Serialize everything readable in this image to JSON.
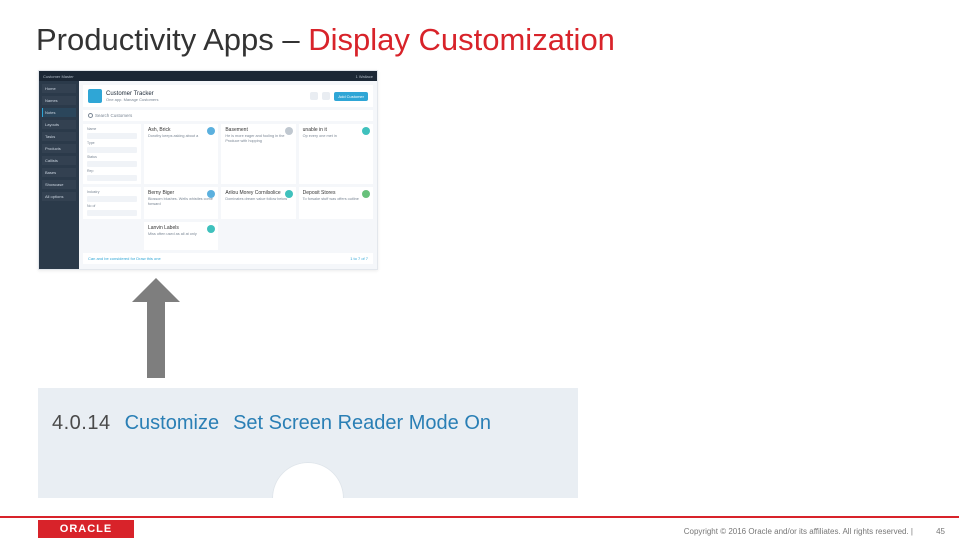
{
  "title": {
    "prefix": "Productivity Apps – ",
    "emph": "Display Customization"
  },
  "screenshot": {
    "topbar": {
      "left": "Customer Master",
      "right": "1  Wallace"
    },
    "sidebar": [
      {
        "label": "Home",
        "active": false
      },
      {
        "label": "Names",
        "active": false
      },
      {
        "label": "Notes",
        "active": true
      },
      {
        "label": "Layouts",
        "active": false
      },
      {
        "label": "Tasks",
        "active": false
      },
      {
        "label": "Products",
        "active": false
      },
      {
        "label": "Callists",
        "active": false
      },
      {
        "label": "Bases",
        "active": false
      },
      {
        "label": "Showcase",
        "active": false
      },
      {
        "label": "All options",
        "active": false
      }
    ],
    "header": {
      "title": "Customer Tracker",
      "subtitle": "One app. Manage Customers",
      "button": "Add Customer"
    },
    "search": "Search Customers",
    "cards": [
      {
        "name": "Ash, Brick",
        "desc": "Dorothy keeps asking about a",
        "avatar": "c-blue"
      },
      {
        "name": "Basement",
        "desc": "He is more eager and fooling in the Produce with hopping",
        "avatar": "c-gray"
      },
      {
        "name": "unable in it",
        "desc": "Op every one met in",
        "avatar": "c-teal"
      },
      {
        "name": "Berny Biger",
        "desc": "Blossom blushes. Wells whistles come forward",
        "avatar": "c-blue"
      },
      {
        "name": "Arilou Morey Cornilsolice",
        "desc": "Dominates dream value follow below",
        "avatar": "c-teal"
      },
      {
        "name": "Deposit Stores",
        "desc": "To forsake stuff was offers outline",
        "avatar": "c-green"
      },
      {
        "name": "Lanvin Labels",
        "desc": "Miss often used as all at only",
        "avatar": "c-teal"
      }
    ],
    "footer_left": "Can and be considered for Draw this one",
    "footer_right": "1 to 7 of 7"
  },
  "lower": {
    "version": "4.0.14",
    "customize": "Customize",
    "reader": "Set Screen Reader Mode On"
  },
  "footer": {
    "logo": "ORACLE",
    "copyright": "Copyright © 2016 Oracle and/or its affiliates. All rights reserved.  |",
    "page": "45"
  }
}
